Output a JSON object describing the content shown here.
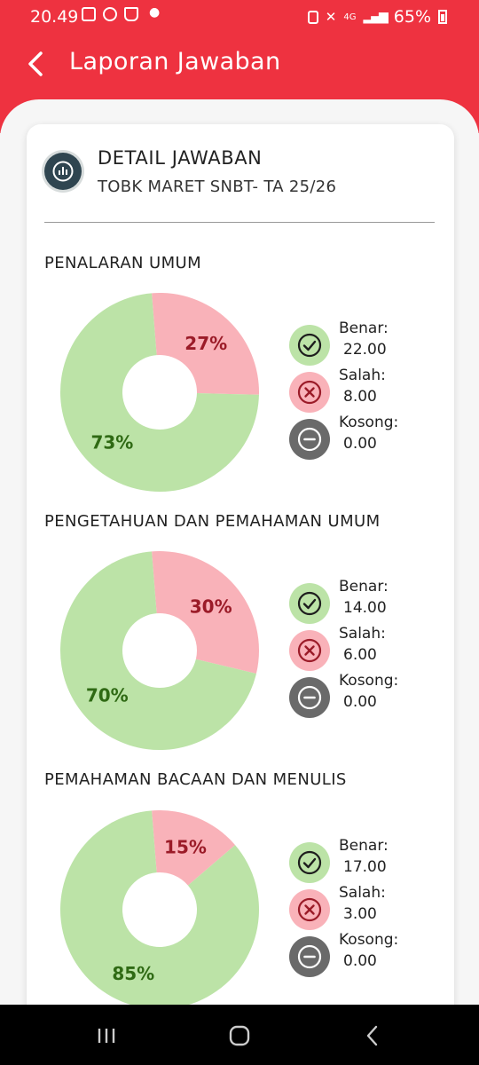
{
  "status_bar": {
    "time": "20.49",
    "network": "4G",
    "battery": "65%"
  },
  "app_bar": {
    "title": "Laporan Jawaban"
  },
  "detail": {
    "title": "DETAIL JAWABAN",
    "subtitle": "TOBK MARET SNBT- TA 25/26"
  },
  "colors": {
    "benar": "#bce3a7",
    "benar_text": "#2f6a14",
    "salah": "#f9b2b9",
    "salah_text": "#9b1b28",
    "kosong": "#6a6a6a",
    "accent": "#ee3240"
  },
  "legend_labels": {
    "benar": "Benar:",
    "salah": "Salah:",
    "kosong": "Kosong:"
  },
  "icons": {
    "back": "back-arrow-icon",
    "report": "bar-chart-icon",
    "benar": "check-circle-icon",
    "salah": "x-circle-icon",
    "kosong": "minus-circle-icon"
  },
  "sections": [
    {
      "title": "PENALARAN UMUM",
      "benar_pct_label": "73%",
      "salah_pct_label": "27%",
      "benar": "22.00",
      "salah": "8.00",
      "kosong": "0.00"
    },
    {
      "title": "PENGETAHUAN DAN PEMAHAMAN UMUM",
      "benar_pct_label": "70%",
      "salah_pct_label": "30%",
      "benar": "14.00",
      "salah": "6.00",
      "kosong": "0.00"
    },
    {
      "title": "PEMAHAMAN BACAAN DAN MENULIS",
      "benar_pct_label": "85%",
      "salah_pct_label": "15%",
      "benar": "17.00",
      "salah": "3.00",
      "kosong": "0.00"
    }
  ],
  "chart_data": [
    {
      "type": "pie",
      "title": "PENALARAN UMUM",
      "categories": [
        "Benar",
        "Salah",
        "Kosong"
      ],
      "values": [
        22,
        8,
        0
      ]
    },
    {
      "type": "pie",
      "title": "PENGETAHUAN DAN PEMAHAMAN UMUM",
      "categories": [
        "Benar",
        "Salah",
        "Kosong"
      ],
      "values": [
        14,
        6,
        0
      ]
    },
    {
      "type": "pie",
      "title": "PEMAHAMAN BACAAN DAN MENULIS",
      "categories": [
        "Benar",
        "Salah",
        "Kosong"
      ],
      "values": [
        17,
        3,
        0
      ]
    }
  ]
}
